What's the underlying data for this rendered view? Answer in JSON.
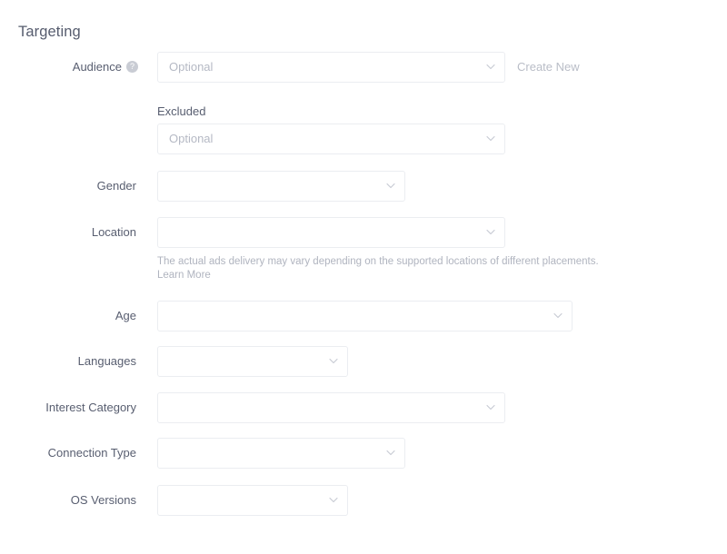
{
  "section": {
    "title": "Targeting"
  },
  "icons": {
    "help": "help-circle-icon",
    "chevron": "chevron-down-icon",
    "help_glyph": "?"
  },
  "fields": {
    "audience": {
      "label": "Audience",
      "placeholder": "Optional",
      "value": "",
      "has_help_icon": true,
      "side_link": "Create New",
      "sub_label": "Excluded",
      "excluded_placeholder": "Optional",
      "excluded_value": ""
    },
    "gender": {
      "label": "Gender",
      "placeholder": "",
      "value": ""
    },
    "location": {
      "label": "Location",
      "placeholder": "",
      "value": "",
      "helper_text": "The actual ads delivery may vary depending on the supported locations of different placements.",
      "helper_link": "Learn More"
    },
    "age": {
      "label": "Age",
      "placeholder": "",
      "value": ""
    },
    "languages": {
      "label": "Languages",
      "placeholder": "",
      "value": ""
    },
    "interest_category": {
      "label": "Interest Category",
      "placeholder": "",
      "value": ""
    },
    "connection_type": {
      "label": "Connection Type",
      "placeholder": "",
      "value": ""
    },
    "os_versions": {
      "label": "OS Versions",
      "placeholder": "",
      "value": ""
    }
  },
  "colors": {
    "background": "#ffffff",
    "label_text": "#585e70",
    "heading_text": "#565c6e",
    "field_border": "#ebedf1",
    "placeholder_text": "#b5b9c4",
    "helper_text": "#b0b4bf",
    "link_muted": "#b9bdc7",
    "help_icon_bg": "#c9ccd4"
  }
}
